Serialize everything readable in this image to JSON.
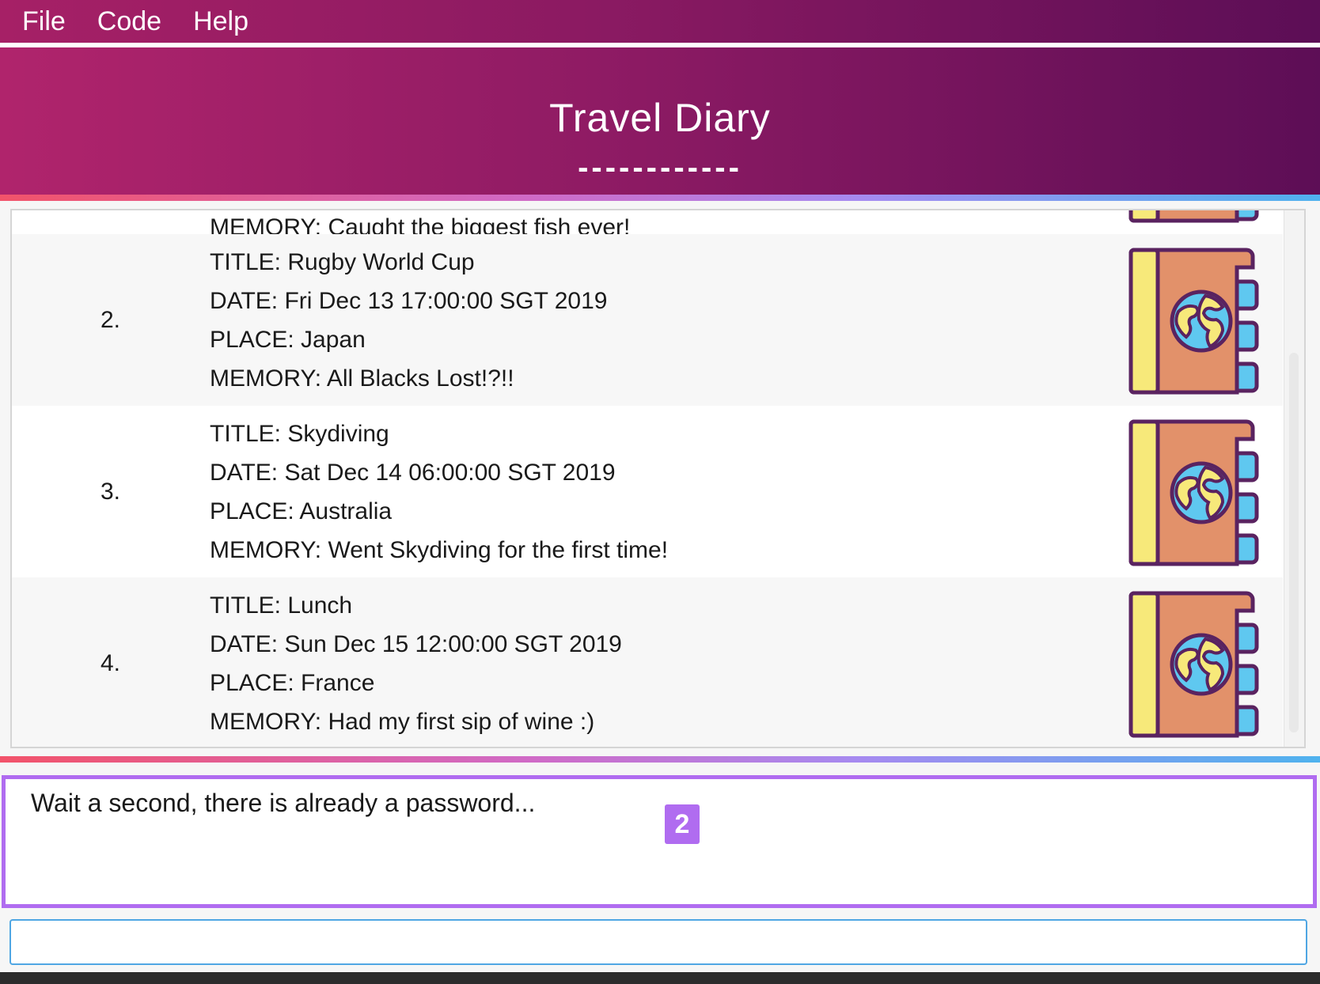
{
  "menu": {
    "items": [
      "File",
      "Code",
      "Help"
    ]
  },
  "header": {
    "title": "Travel Diary",
    "underline": "------------"
  },
  "list": {
    "partial_first_line": "MEMORY: Caught the biggest fish ever!",
    "entries": [
      {
        "index": "2.",
        "lines": [
          "TITLE: Rugby World Cup",
          "DATE: Fri Dec 13 17:00:00 SGT 2019",
          "PLACE: Japan",
          "MEMORY: All Blacks Lost!?!!"
        ]
      },
      {
        "index": "3.",
        "lines": [
          "TITLE: Skydiving",
          "DATE: Sat Dec 14 06:00:00 SGT 2019",
          "PLACE: Australia",
          "MEMORY: Went Skydiving for the first time!"
        ]
      },
      {
        "index": "4.",
        "lines": [
          "TITLE: Lunch",
          "DATE: Sun Dec 15 12:00:00 SGT 2019",
          "PLACE: France",
          "MEMORY: Had my first sip of wine :)"
        ]
      }
    ],
    "icon": "travel-diary-book-icon"
  },
  "result": {
    "message": "Wait a second, there is already a password...",
    "badge": "2"
  },
  "command": {
    "value": "",
    "placeholder": ""
  },
  "colors": {
    "header_start": "#b0246c",
    "header_end": "#5d0e56",
    "accent_purple": "#b06cf0",
    "input_border": "#4fa6e3",
    "book_orange": "#e2916a",
    "book_yellow": "#f7e97a",
    "book_tab_blue": "#5fc8f0",
    "book_outline": "#5a2360"
  }
}
